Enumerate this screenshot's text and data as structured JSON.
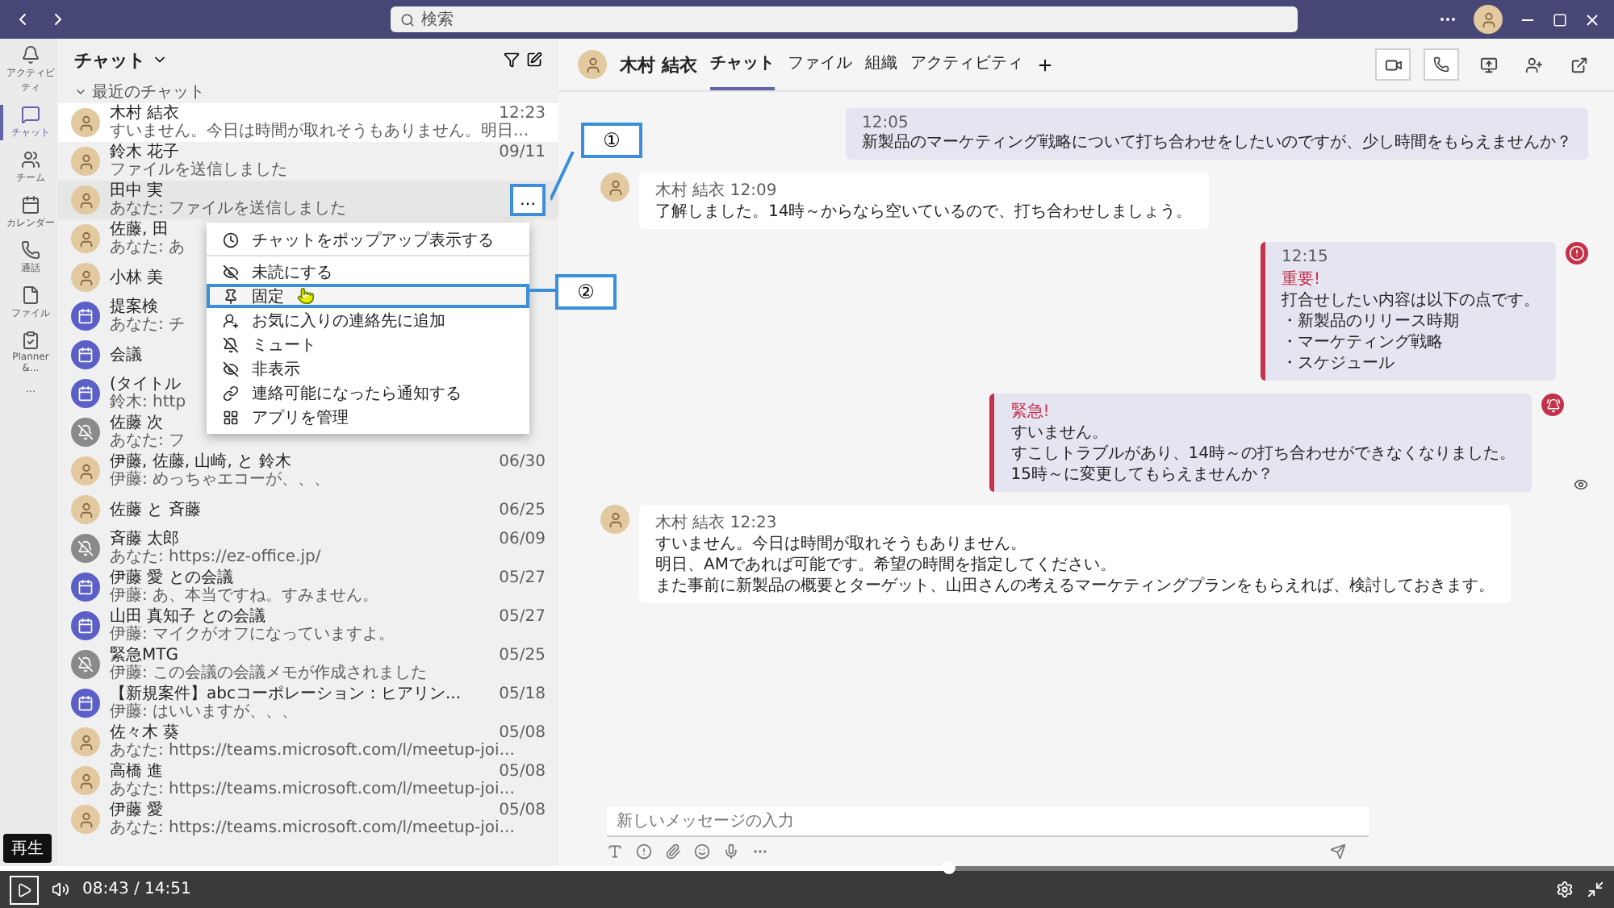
{
  "search": {
    "placeholder": "検索"
  },
  "rail": [
    {
      "kind": "bell",
      "label": "アクティビティ",
      "selected": false
    },
    {
      "kind": "chat",
      "label": "チャット",
      "selected": true
    },
    {
      "kind": "team",
      "label": "チーム",
      "selected": false
    },
    {
      "kind": "calendar",
      "label": "カレンダー",
      "selected": false
    },
    {
      "kind": "call",
      "label": "通話",
      "selected": false
    },
    {
      "kind": "file",
      "label": "ファイル",
      "selected": false
    },
    {
      "kind": "planner",
      "label": "Planner &...",
      "selected": false
    },
    {
      "kind": "more",
      "label": "…",
      "selected": false
    }
  ],
  "chat_list": {
    "title": "チャット",
    "section": "最近のチャット",
    "items": [
      {
        "kind": "person",
        "name": "木村 結衣",
        "time": "12:23",
        "preview": "すいません。今日は時間が取れそうもありません。明日...",
        "selected": true
      },
      {
        "kind": "person",
        "name": "鈴木 花子",
        "time": "09/11",
        "preview": "ファイルを送信しました",
        "selected": false
      },
      {
        "kind": "person",
        "name": "田中 実",
        "preview": "あなた: ファイルを送信しました",
        "selected": false,
        "more_button": {
          "label": "…",
          "highlighted": true
        }
      },
      {
        "kind": "person",
        "name": "佐藤, 田",
        "preview": "あなた: あ",
        "selected": false
      },
      {
        "kind": "person",
        "name": "小林 美",
        "selected": false
      },
      {
        "kind": "meeting",
        "name": "提案検",
        "preview": "あなた: チ",
        "selected": false
      },
      {
        "kind": "meeting",
        "name": "会議",
        "selected": false
      },
      {
        "kind": "meeting",
        "name": "(タイトル",
        "preview": "鈴木: http",
        "selected": false
      },
      {
        "kind": "blocked",
        "name": "佐藤 次",
        "preview": "あなた: フ",
        "selected": false
      },
      {
        "kind": "person",
        "name": "伊藤, 佐藤, 山崎, と 鈴木",
        "time": "06/30",
        "preview": "伊藤: めっちゃエコーが、、、",
        "selected": false
      },
      {
        "kind": "person",
        "name": "佐藤 と 斉藤",
        "time": "06/25",
        "selected": false
      },
      {
        "kind": "blocked",
        "name": "斉藤 太郎",
        "time": "06/09",
        "preview": "あなた: https://ez-office.jp/",
        "selected": false
      },
      {
        "kind": "meeting",
        "name": "伊藤 愛 との会議",
        "time": "05/27",
        "preview": "伊藤: あ、本当ですね。すみません。",
        "selected": false
      },
      {
        "kind": "meeting",
        "name": "山田 真知子 との会議",
        "time": "05/27",
        "preview": "伊藤: マイクがオフになっていますよ。",
        "selected": false
      },
      {
        "kind": "blocked",
        "name": "緊急MTG",
        "time": "05/25",
        "preview": "伊藤: この会議の会議メモが作成されました",
        "selected": false
      },
      {
        "kind": "meeting",
        "name": "【新規案件】abcコーポレーション：ヒアリン...",
        "time": "05/18",
        "preview": "伊藤: はいいますが、、、",
        "selected": false
      },
      {
        "kind": "person",
        "name": "佐々木 葵",
        "time": "05/08",
        "preview": "あなた: https://teams.microsoft.com/l/meetup-joi...",
        "selected": false
      },
      {
        "kind": "person",
        "name": "高橋 進",
        "time": "05/08",
        "preview": "あなた: https://teams.microsoft.com/l/meetup-joi...",
        "selected": false
      },
      {
        "kind": "person",
        "name": "伊藤 愛",
        "time": "05/08",
        "preview": "あなた: https://teams.microsoft.com/l/meetup-joi...",
        "selected": false
      }
    ]
  },
  "context_menu": [
    {
      "kind": "popout",
      "label": "チャットをポップアップ表示する",
      "highlighted": false,
      "divider_after": true
    },
    {
      "kind": "unread",
      "label": "未読にする",
      "highlighted": false
    },
    {
      "kind": "pin",
      "label": "固定",
      "highlighted": true
    },
    {
      "kind": "favorite",
      "label": "お気に入りの連絡先に追加",
      "highlighted": false
    },
    {
      "kind": "mute",
      "label": "ミュート",
      "highlighted": false
    },
    {
      "kind": "hide",
      "label": "非表示",
      "highlighted": false
    },
    {
      "kind": "notify",
      "label": "連絡可能になったら通知する",
      "highlighted": false
    },
    {
      "kind": "apps",
      "label": "アプリを管理",
      "highlighted": false
    }
  ],
  "annotations": [
    {
      "kind": "button",
      "label": "①"
    },
    {
      "kind": "menu",
      "label": "②"
    }
  ],
  "conversation": {
    "name": "木村 結衣",
    "tabs": [
      {
        "label": "チャット",
        "selected": true
      },
      {
        "label": "ファイル",
        "selected": false
      },
      {
        "label": "組織",
        "selected": false
      },
      {
        "label": "アクティビティ",
        "selected": false
      }
    ],
    "messages": [
      {
        "kind": "sent",
        "time": "12:05",
        "lines": [
          "新製品のマーケティング戦略について打ち合わせをしたいのですが、少し時間をもらえませんか？"
        ]
      },
      {
        "kind": "received",
        "author": "木村 結衣",
        "time": "12:09",
        "lines": [
          "了解しました。14時～からなら空いているので、打ち合わせしましょう。"
        ]
      },
      {
        "kind": "sent",
        "time": "12:15",
        "flag": {
          "kind": "important",
          "label": "重要!"
        },
        "lines": [
          "打合せしたい内容は以下の点です。",
          "・新製品のリリース時期",
          "・マーケティング戦略",
          "・スケジュール"
        ]
      },
      {
        "kind": "sent",
        "flag": {
          "kind": "urgent",
          "label": "緊急!"
        },
        "seen": true,
        "lines": [
          "すいません。",
          "すこしトラブルがあり、14時～の打ち合わせができなくなりました。",
          "15時～に変更してもらえませんか？"
        ]
      },
      {
        "kind": "received",
        "author": "木村 結衣",
        "time": "12:23",
        "lines": [
          "すいません。今日は時間が取れそうもありません。",
          "明日、AMであれば可能です。希望の時間を指定してください。",
          "また事前に新製品の概要とターゲット、山田さんの考えるマーケティングプランをもらえれば、検討しておきます。"
        ]
      }
    ],
    "composer": {
      "placeholder": "新しいメッセージの入力"
    }
  },
  "player": {
    "tooltip": "再生",
    "time": "08:43 / 14:51",
    "level": 0.588
  }
}
